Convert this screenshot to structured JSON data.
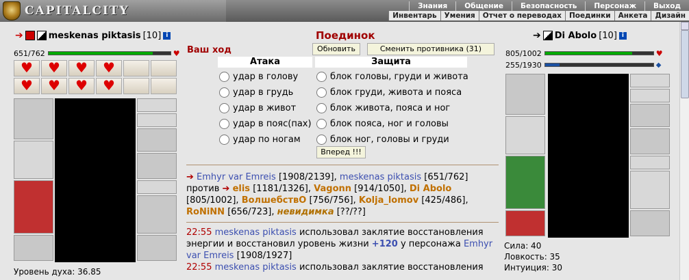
{
  "header": {
    "logo": "CAPITALCITY",
    "nav_top": [
      "Знания",
      "Общение",
      "Безопасность",
      "Персонаж",
      "Выход"
    ],
    "nav_bottom": [
      "Инвентарь",
      "Умения",
      "Отчет о переводах",
      "Поединки",
      "Анкета",
      "Дизайн"
    ]
  },
  "left_player": {
    "name": "meskenas piktasis",
    "level": "[10]",
    "info": "i",
    "hp": "651/762",
    "hp_fraction": 0.854,
    "spirit_level": "Уровень духа: 36.85"
  },
  "right_player": {
    "name": "Di Abolo",
    "level": "[10]",
    "info": "i",
    "hp": "805/1002",
    "hp_fraction": 0.803,
    "mana": "255/1930",
    "mana_fraction": 0.132,
    "stats": [
      "Сила: 40",
      "Ловкость: 35",
      "Интуиция: 30"
    ]
  },
  "duel": {
    "title": "Поединок",
    "your_turn": "Ваш ход",
    "refresh": "Обновить",
    "change_opponent": "Сменить противника (31)",
    "attack_title": "Атака",
    "defense_title": "Защита",
    "attacks": [
      "удар в голову",
      "удар в грудь",
      "удар в живот",
      "удар в пояс(пах)",
      "удар по ногам"
    ],
    "defenses": [
      "блок головы, груди и живота",
      "блок груди, живота и пояса",
      "блок живота, пояса и ног",
      "блок пояса, ног и головы",
      "блок ног, головы и груди"
    ],
    "forward": "Вперед !!!"
  },
  "log_team": {
    "p1": "Emhyr var Emreis",
    "p1_hp": "[1908/2139],",
    "p2": "meskenas piktasis",
    "p2_hp": "[651/762]",
    "vs": "против",
    "e1": "elis",
    "e1_hp": "[1181/1326],",
    "e2": "Vagonn",
    "e2_hp": "[914/1050],",
    "e3": "Di Abolo",
    "e3_hp": "[805/1002],",
    "e4": "ВолшебствО",
    "e4_hp": "[756/756],",
    "e5": "Kolja_lomov",
    "e5_hp": "[425/486],",
    "e6": "RoNiNN",
    "e6_hp": "[656/723],",
    "e7": "невидимка",
    "e7_hp": "[??/??]"
  },
  "log_entries": {
    "time1": "22:55",
    "actor1": "meskenas piktasis",
    "text1a": "использовал заклятие восстановления энергии и восстановил уровень жизни",
    "amount1": "+120",
    "text1b": "у персонажа",
    "target1": "Emhyr var Emreis",
    "target1_hp": "[1908/1927]",
    "time2": "22:55",
    "actor2": "meskenas piktasis",
    "text2a": "использовал заклятие восстановления"
  }
}
